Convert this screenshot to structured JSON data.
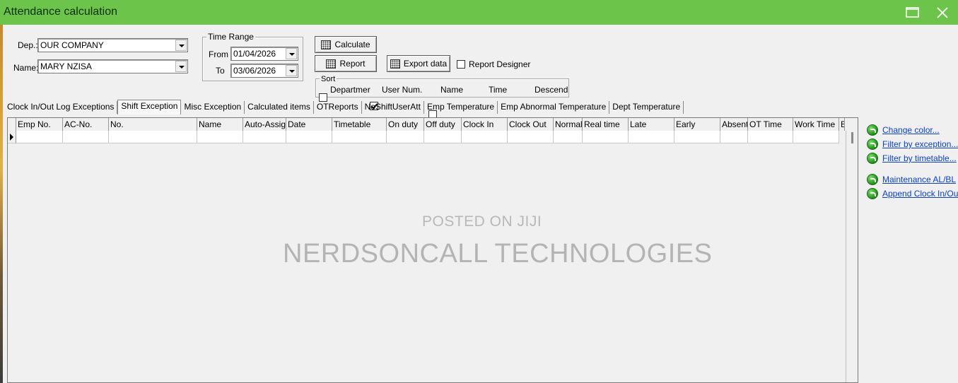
{
  "window": {
    "title": "Attendance calculation",
    "title_bar_color": "#6cc54a"
  },
  "filters": {
    "dep_label": "Dep.:",
    "dep_value": "OUR COMPANY",
    "name_label": "Name:",
    "name_value": "MARY NZISA"
  },
  "time_range": {
    "group_label": "Time Range",
    "from_label": "From",
    "from_value": "01/04/2026",
    "to_label": "To",
    "to_value": "03/06/2026"
  },
  "buttons": {
    "calculate": "Calculate",
    "report": "Report",
    "export_data": "Export data"
  },
  "report_designer": {
    "label": "Report Designer",
    "checked": false
  },
  "sort": {
    "group_label": "Sort",
    "options": [
      {
        "label": "Departmer",
        "checked": false
      },
      {
        "label": "User Num.",
        "checked": true
      },
      {
        "label": "Name",
        "checked": false
      },
      {
        "label": "Time",
        "checked": false
      },
      {
        "label": "Descend",
        "checked": false
      }
    ]
  },
  "tabs": [
    "Clock In/Out Log Exceptions",
    "Shift Exception",
    "Misc Exception",
    "Calculated items",
    "OTReports",
    "NoShiftUserAtt",
    "Emp Temperature",
    "Emp Abnormal Temperature",
    "Dept Temperature"
  ],
  "active_tab": "Shift Exception",
  "grid": {
    "columns": [
      "Emp No.",
      "AC-No.",
      "No.",
      "Name",
      "Auto-Assign",
      "Date",
      "Timetable",
      "On duty",
      "Off duty",
      "Clock In",
      "Clock Out",
      "Normal",
      "Real time",
      "Late",
      "Early",
      "Absent",
      "OT Time",
      "Work Time",
      "E"
    ]
  },
  "watermark": {
    "line1": "POSTED ON JIJI",
    "line2": "NERDSONCALL TECHNOLOGIES"
  },
  "side_links": [
    {
      "label": "Change color...",
      "icon": "green-arrow-icon"
    },
    {
      "label": "Filter by exception...",
      "icon": "green-arrow-icon"
    },
    {
      "label": "Filter by timetable...",
      "icon": "green-arrow-icon"
    },
    {
      "label": "Maintenance AL/BL",
      "icon": "green-arrow-icon"
    },
    {
      "label": "Append Clock In/Out l",
      "icon": "green-arrow-icon"
    }
  ]
}
